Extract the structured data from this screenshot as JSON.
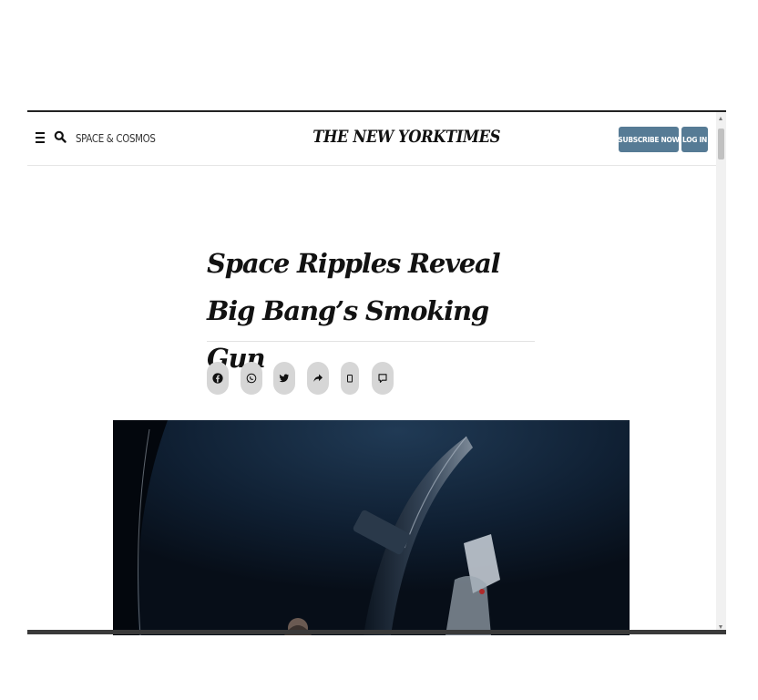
{
  "header": {
    "section_name": "SPACE & COSMOS",
    "logo": "THE NEW YORKTIMES",
    "subscribe_label": "SUBSCRIBE NOW",
    "login_label": "LOG IN"
  },
  "article": {
    "headline": "Space Ripples Reveal Big Bang’s Smoking Gun"
  },
  "share_icons": [
    "facebook-icon",
    "whatsapp-icon",
    "twitter-icon",
    "share-icon",
    "save-icon",
    "comment-icon"
  ],
  "colors": {
    "button_bg": "#567b95",
    "share_bg": "#d6d6d6",
    "text": "#121212"
  }
}
